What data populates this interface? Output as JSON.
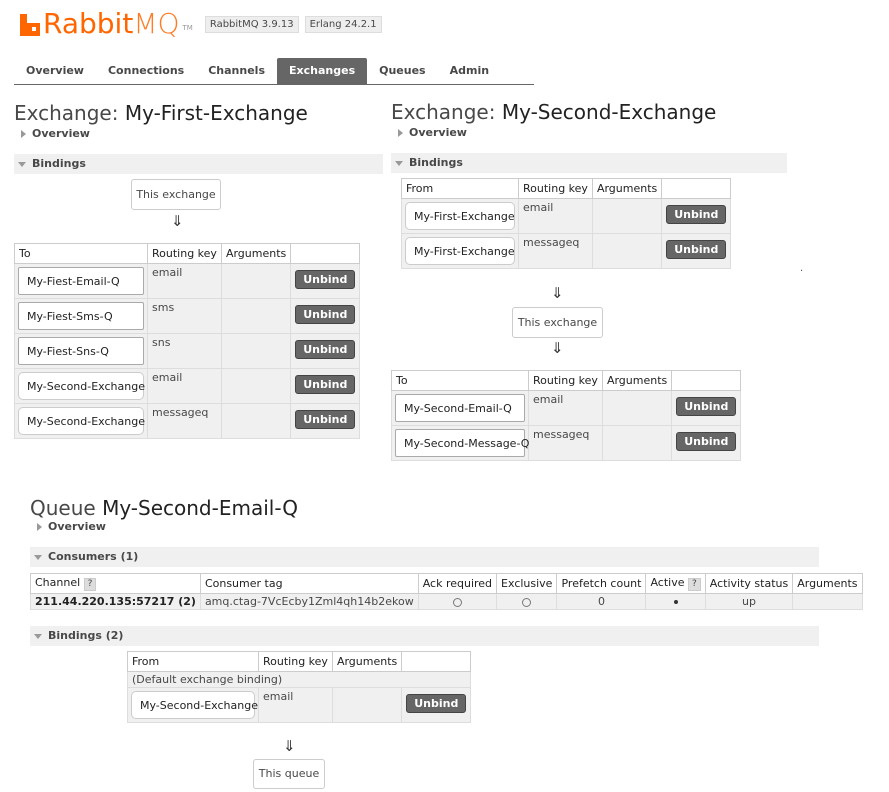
{
  "header": {
    "logo_rabbit": "Rabbit",
    "logo_mq": "MQ",
    "tm": "TM",
    "version": "RabbitMQ 3.9.13",
    "erlang": "Erlang 24.2.1"
  },
  "tabs": [
    {
      "label": "Overview"
    },
    {
      "label": "Connections"
    },
    {
      "label": "Channels"
    },
    {
      "label": "Exchanges",
      "active": true
    },
    {
      "label": "Queues"
    },
    {
      "label": "Admin"
    }
  ],
  "exchange1": {
    "title_prefix": "Exchange:",
    "title_name": "My-First-Exchange",
    "overview": "Overview",
    "bindings": "Bindings",
    "this_exchange": "This exchange",
    "arrow": "⇓",
    "columns": [
      "To",
      "Routing key",
      "Arguments",
      ""
    ],
    "rows": [
      {
        "to": "My-Fiest-Email-Q",
        "key": "email",
        "button": "Unbind"
      },
      {
        "to": "My-Fiest-Sms-Q",
        "key": "sms",
        "button": "Unbind"
      },
      {
        "to": "My-Fiest-Sns-Q",
        "key": "sns",
        "button": "Unbind"
      },
      {
        "to": "My-Second-Exchange",
        "key": "email",
        "button": "Unbind"
      },
      {
        "to": "My-Second-Exchange",
        "key": "messageq",
        "button": "Unbind"
      }
    ]
  },
  "exchange2": {
    "title_prefix": "Exchange:",
    "title_name": "My-Second-Exchange",
    "overview": "Overview",
    "bindings": "Bindings",
    "from_columns": [
      "From",
      "Routing key",
      "Arguments",
      ""
    ],
    "from_rows": [
      {
        "from": "My-First-Exchange",
        "key": "email",
        "button": "Unbind"
      },
      {
        "from": "My-First-Exchange",
        "key": "messageq",
        "button": "Unbind"
      }
    ],
    "arrow": "⇓",
    "this_exchange": "This exchange",
    "to_columns": [
      "To",
      "Routing key",
      "Arguments",
      ""
    ],
    "to_rows": [
      {
        "to": "My-Second-Email-Q",
        "key": "email",
        "button": "Unbind"
      },
      {
        "to": "My-Second-Message-Q",
        "key": "messageq",
        "button": "Unbind"
      }
    ],
    "stray_dot": "."
  },
  "queue": {
    "title_prefix": "Queue",
    "title_name": "My-Second-Email-Q",
    "overview": "Overview",
    "consumers": "Consumers (1)",
    "consumer_columns": [
      "Channel",
      "Consumer tag",
      "Ack required",
      "Exclusive",
      "Prefetch count",
      "Active",
      "Activity status",
      "Arguments"
    ],
    "help": "?",
    "consumer_row": {
      "channel": "211.44.220.135:57217 (2)",
      "tag": "amq.ctag-7VcEcby1Zml4qh14b2ekow",
      "prefetch": "0",
      "status": "up"
    },
    "bindings": "Bindings (2)",
    "binding_columns": [
      "From",
      "Routing key",
      "Arguments",
      ""
    ],
    "default_binding": "(Default exchange binding)",
    "binding_row": {
      "from": "My-Second-Exchange",
      "key": "email",
      "button": "Unbind"
    },
    "arrow": "⇓",
    "this_queue": "This queue"
  }
}
